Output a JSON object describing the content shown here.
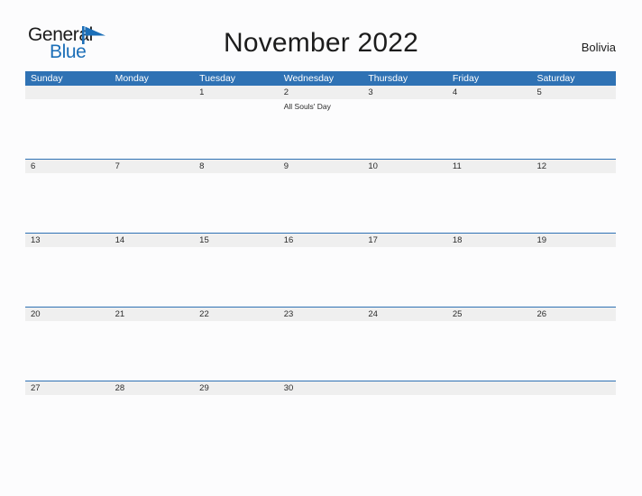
{
  "brand": {
    "name_part1": "General",
    "name_part2": "Blue",
    "flag_icon": "blue-triangle-flag-icon",
    "accent_color": "#1c6fb8"
  },
  "header": {
    "title": "November 2022",
    "country": "Bolivia"
  },
  "theme": {
    "header_blue": "#2f72b4",
    "band_gray": "#efefef",
    "page_background": "#fcfcfd",
    "text_color": "#2b2b2b"
  },
  "calendar": {
    "month": "November",
    "year": "2022",
    "weekdays": [
      "Sunday",
      "Monday",
      "Tuesday",
      "Wednesday",
      "Thursday",
      "Friday",
      "Saturday"
    ],
    "weeks": [
      {
        "days": [
          {
            "num": "",
            "events": []
          },
          {
            "num": "",
            "events": []
          },
          {
            "num": "1",
            "events": []
          },
          {
            "num": "2",
            "events": [
              "All Souls' Day"
            ]
          },
          {
            "num": "3",
            "events": []
          },
          {
            "num": "4",
            "events": []
          },
          {
            "num": "5",
            "events": []
          }
        ]
      },
      {
        "days": [
          {
            "num": "6",
            "events": []
          },
          {
            "num": "7",
            "events": []
          },
          {
            "num": "8",
            "events": []
          },
          {
            "num": "9",
            "events": []
          },
          {
            "num": "10",
            "events": []
          },
          {
            "num": "11",
            "events": []
          },
          {
            "num": "12",
            "events": []
          }
        ]
      },
      {
        "days": [
          {
            "num": "13",
            "events": []
          },
          {
            "num": "14",
            "events": []
          },
          {
            "num": "15",
            "events": []
          },
          {
            "num": "16",
            "events": []
          },
          {
            "num": "17",
            "events": []
          },
          {
            "num": "18",
            "events": []
          },
          {
            "num": "19",
            "events": []
          }
        ]
      },
      {
        "days": [
          {
            "num": "20",
            "events": []
          },
          {
            "num": "21",
            "events": []
          },
          {
            "num": "22",
            "events": []
          },
          {
            "num": "23",
            "events": []
          },
          {
            "num": "24",
            "events": []
          },
          {
            "num": "25",
            "events": []
          },
          {
            "num": "26",
            "events": []
          }
        ]
      },
      {
        "days": [
          {
            "num": "27",
            "events": []
          },
          {
            "num": "28",
            "events": []
          },
          {
            "num": "29",
            "events": []
          },
          {
            "num": "30",
            "events": []
          },
          {
            "num": "",
            "events": []
          },
          {
            "num": "",
            "events": []
          },
          {
            "num": "",
            "events": []
          }
        ]
      }
    ]
  }
}
